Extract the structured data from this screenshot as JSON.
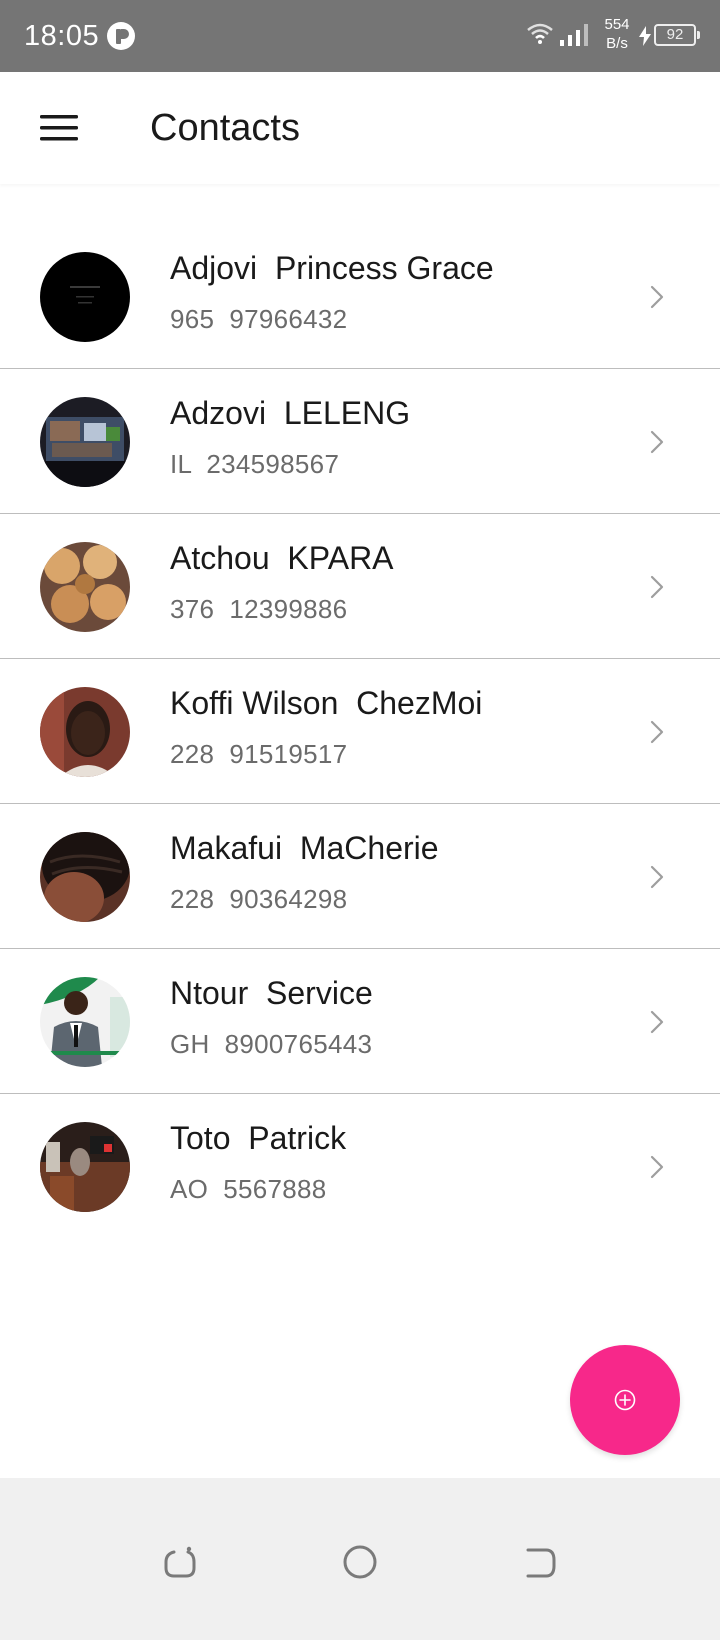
{
  "status_bar": {
    "time": "18:05",
    "net_speed_value": "554",
    "net_speed_unit": "B/s",
    "battery": "92"
  },
  "app_bar": {
    "title": "Contacts"
  },
  "contacts": [
    {
      "first": "Adjovi",
      "last": "Princess Grace",
      "name": "Adjovi  Princess Grace",
      "phone": "965  97966432"
    },
    {
      "first": "Adzovi",
      "last": "LELENG",
      "name": "Adzovi  LELENG",
      "phone": "IL  234598567"
    },
    {
      "first": "Atchou",
      "last": "KPARA",
      "name": "Atchou  KPARA",
      "phone": "376  12399886"
    },
    {
      "first": "Koffi Wilson",
      "last": "ChezMoi",
      "name": "Koffi Wilson  ChezMoi",
      "phone": "228  91519517"
    },
    {
      "first": "Makafui",
      "last": "MaCherie",
      "name": "Makafui  MaCherie",
      "phone": "228  90364298"
    },
    {
      "first": "Ntour",
      "last": "Service",
      "name": "Ntour  Service",
      "phone": "GH  8900765443"
    },
    {
      "first": "Toto",
      "last": "Patrick",
      "name": "Toto  Patrick",
      "phone": "AO  5567888"
    }
  ],
  "icons": {
    "menu": "hamburger-menu-icon",
    "row_action": "chevron-right-icon",
    "fab": "add-circle-icon",
    "nav_recents": "recents-icon",
    "nav_home": "home-icon",
    "nav_back": "back-icon"
  },
  "colors": {
    "status_bar": "#757575",
    "fab": "#f7288a",
    "divider": "#bdbdbd",
    "secondary_text": "#6b6b6b",
    "nav_bar": "#f0f0f0"
  }
}
